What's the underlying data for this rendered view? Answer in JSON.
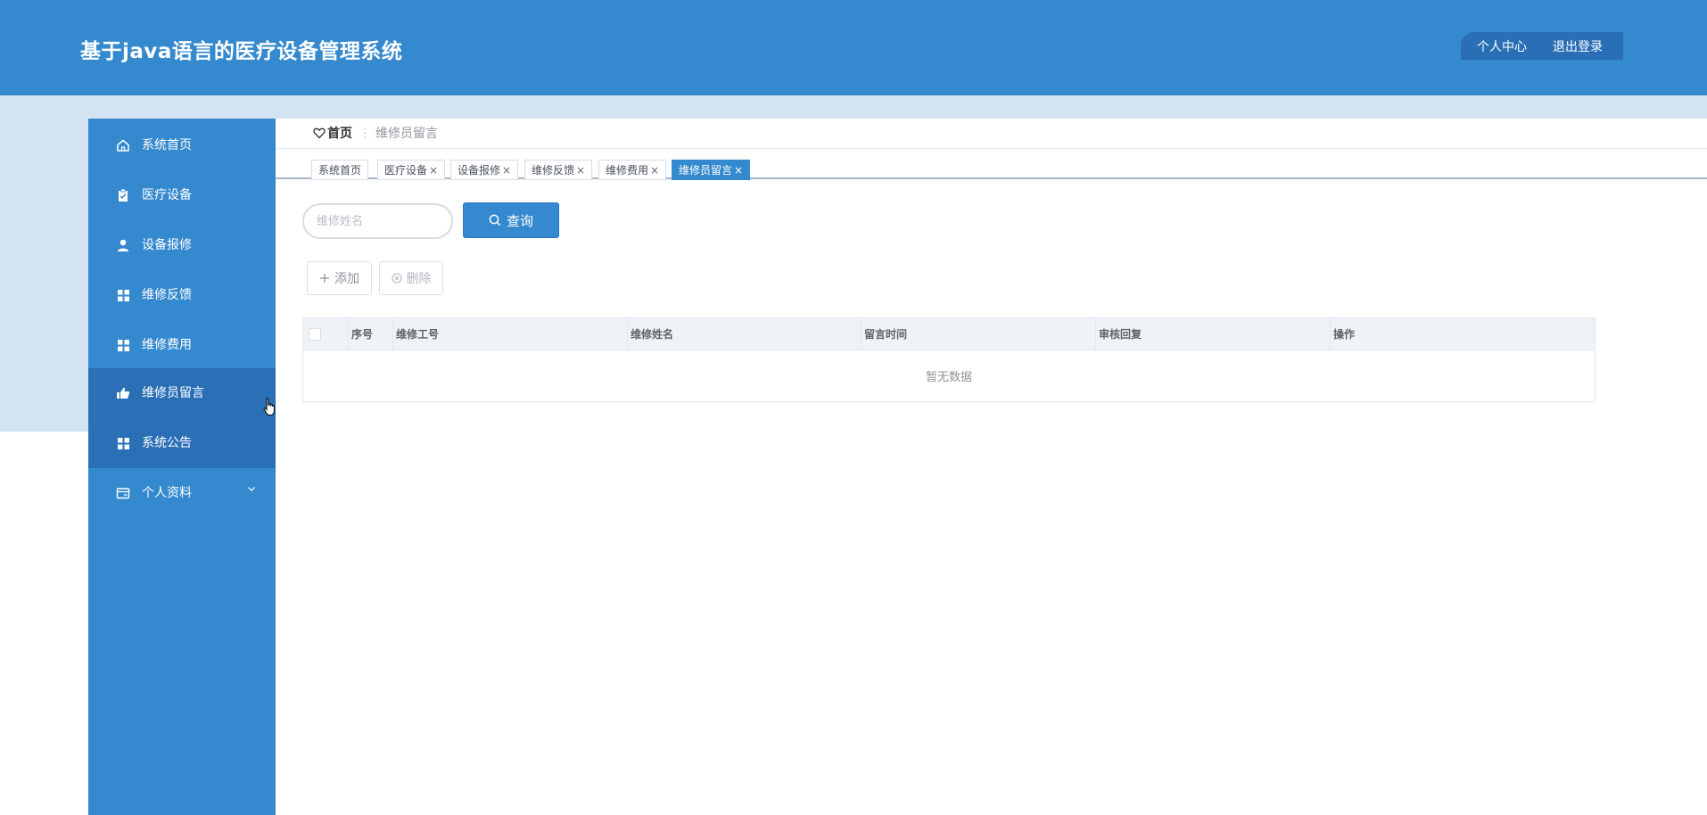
{
  "header": {
    "title": "基于java语言的医疗设备管理系统",
    "personal_center": "个人中心",
    "logout": "退出登录"
  },
  "sidebar": {
    "items": [
      {
        "label": "系统首页",
        "icon": "home-icon"
      },
      {
        "label": "医疗设备",
        "icon": "clipboard-icon"
      },
      {
        "label": "设备报修",
        "icon": "user-icon"
      },
      {
        "label": "维修反馈",
        "icon": "grid-icon"
      },
      {
        "label": "维修费用",
        "icon": "grid-icon"
      },
      {
        "label": "维修员留言",
        "icon": "thumb-up-icon",
        "active": true
      },
      {
        "label": "系统公告",
        "icon": "grid-icon"
      },
      {
        "label": "个人资料",
        "icon": "card-icon",
        "expandable": true
      }
    ]
  },
  "breadcrumb": {
    "home": "首页",
    "separator": "⋮",
    "current": "维修员留言"
  },
  "tabs": [
    {
      "label": "系统首页",
      "closable": false
    },
    {
      "label": "医疗设备",
      "closable": true
    },
    {
      "label": "设备报修",
      "closable": true
    },
    {
      "label": "维修反馈",
      "closable": true
    },
    {
      "label": "维修费用",
      "closable": true
    },
    {
      "label": "维修员留言",
      "closable": true,
      "active": true
    }
  ],
  "tab_close_glyph": "×",
  "search": {
    "placeholder": "维修姓名",
    "value": "",
    "button_label": "查询"
  },
  "actions": {
    "add_label": "添加",
    "delete_label": "删除"
  },
  "table": {
    "columns": [
      "序号",
      "维修工号",
      "维修姓名",
      "留言时间",
      "审核回复",
      "操作"
    ],
    "rows": [],
    "empty_text": "暂无数据"
  },
  "colors": {
    "primary": "#3589cf",
    "sidebar_active": "#2b6fb7",
    "background_band": "#d3e3f1"
  }
}
